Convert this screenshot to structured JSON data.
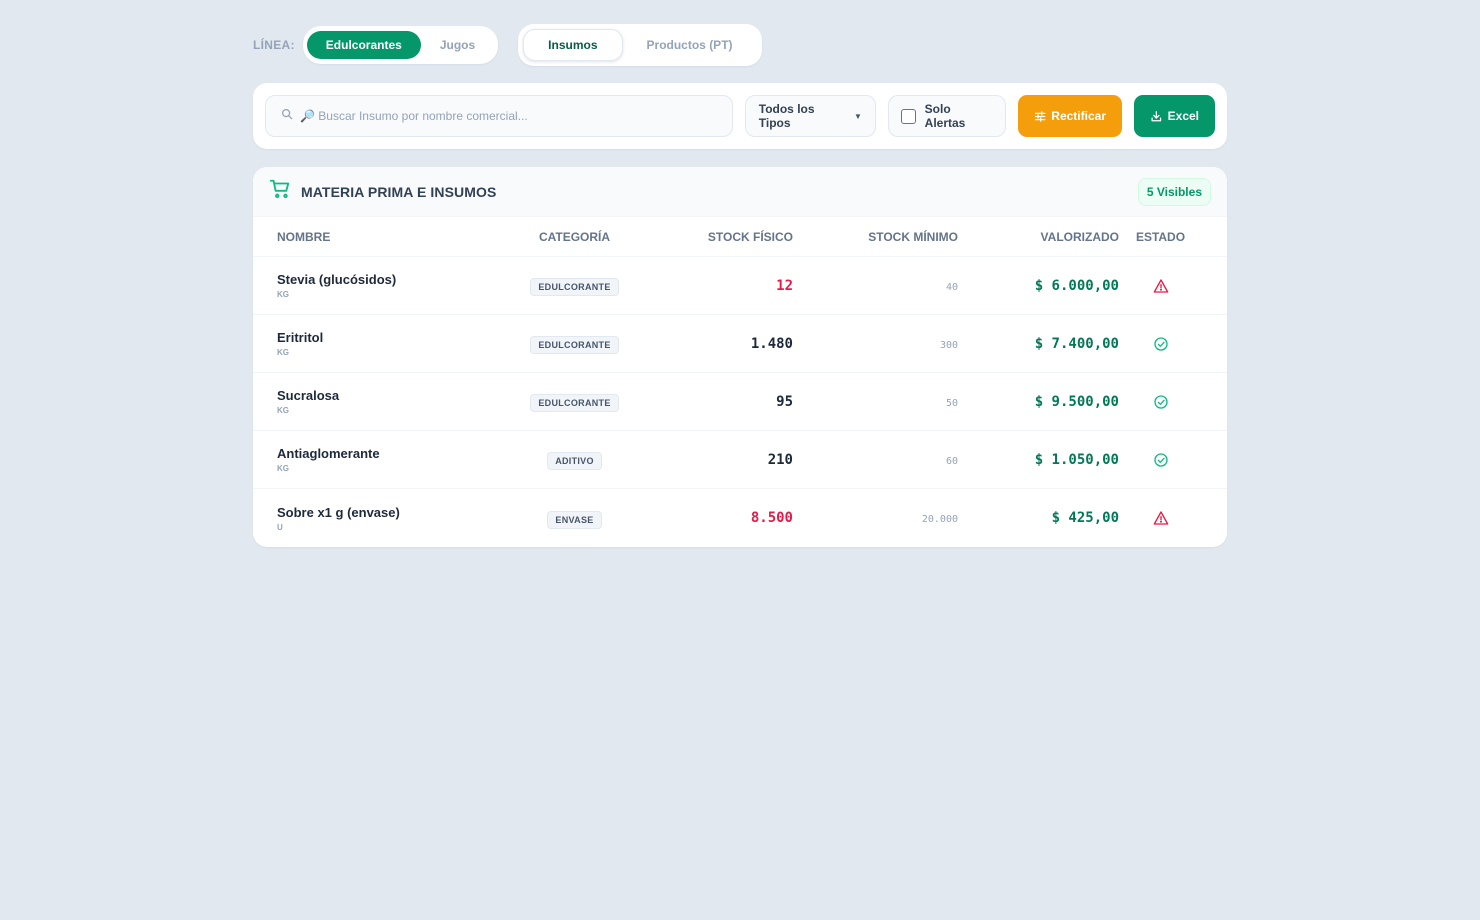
{
  "linea": {
    "label": "LÍNEA:",
    "options": [
      "Edulcorantes",
      "Jugos"
    ],
    "selected": "Edulcorantes"
  },
  "view_tabs": {
    "options": [
      "Insumos",
      "Productos (PT)"
    ],
    "selected": "Insumos"
  },
  "toolbar": {
    "search_placeholder": "🔎 Buscar Insumo por nombre comercial...",
    "search_value": "",
    "type_filter": "Todos los Tipos",
    "alerts_label": "Solo Alertas",
    "alerts_checked": false,
    "rectify_label": "Rectificar",
    "excel_label": "Excel"
  },
  "table": {
    "title": "MATERIA PRIMA E INSUMOS",
    "visible_count": "5 Visibles",
    "columns": [
      "NOMBRE",
      "CATEGORÍA",
      "STOCK FÍSICO",
      "STOCK MÍNIMO",
      "VALORIZADO",
      "ESTADO"
    ],
    "rows": [
      {
        "name": "Stevia (glucósidos)",
        "unit": "KG",
        "category": "EDULCORANTE",
        "stock": "12",
        "min": "40",
        "value": "$ 6.000,00",
        "status": "alert"
      },
      {
        "name": "Eritritol",
        "unit": "KG",
        "category": "EDULCORANTE",
        "stock": "1.480",
        "min": "300",
        "value": "$ 7.400,00",
        "status": "ok"
      },
      {
        "name": "Sucralosa",
        "unit": "KG",
        "category": "EDULCORANTE",
        "stock": "95",
        "min": "50",
        "value": "$ 9.500,00",
        "status": "ok"
      },
      {
        "name": "Antiaglomerante",
        "unit": "KG",
        "category": "ADITIVO",
        "stock": "210",
        "min": "60",
        "value": "$ 1.050,00",
        "status": "ok"
      },
      {
        "name": "Sobre x1 g (envase)",
        "unit": "U",
        "category": "ENVASE",
        "stock": "8.500",
        "min": "20.000",
        "value": "$ 425,00",
        "status": "alert"
      }
    ]
  },
  "colors": {
    "accent_green": "#059669",
    "accent_orange": "#f59e0b",
    "alert_red": "#e11d48",
    "background": "#e2e8f0"
  }
}
